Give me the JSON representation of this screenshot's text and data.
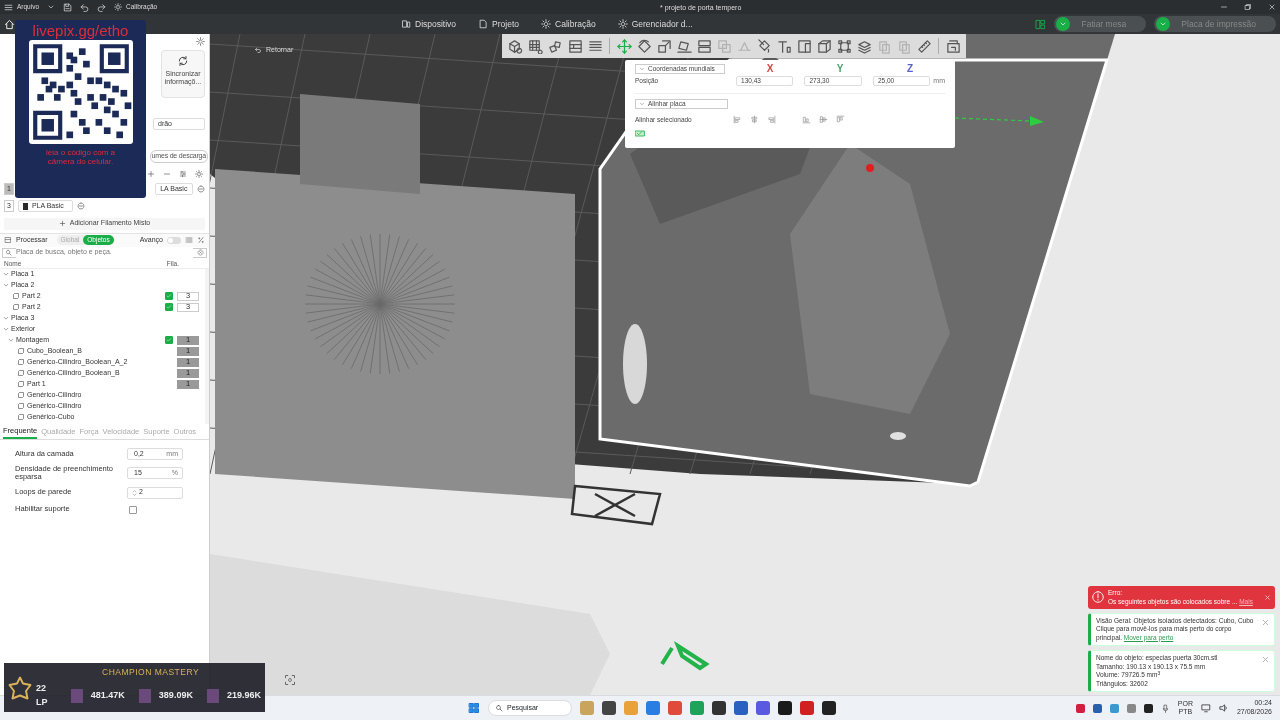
{
  "window": {
    "menu": "Arquivo",
    "quick_action": "Calibração",
    "title": "* projeto de porta tempero"
  },
  "tabs": [
    {
      "label": "Dispositivo",
      "selected": false
    },
    {
      "label": "Projeto",
      "selected": false
    },
    {
      "label": "Calibração",
      "selected": false
    },
    {
      "label": "Gerenciador d...",
      "selected": false
    }
  ],
  "actions": [
    {
      "label": "Fatiar mesa",
      "disabled": true
    },
    {
      "label": "Placa de impressão",
      "disabled": true
    }
  ],
  "left_panel": {
    "sync_button": "Sincronizar informaçõ...",
    "nozzle_field": "drão",
    "flush_button": "umes de descarga",
    "filaments": [
      {
        "number": "1",
        "name": "LA Basic"
      },
      {
        "number": "3",
        "name": "PLA Basic",
        "color": "#2a2a2a"
      }
    ],
    "add_mixed": "Adicionar Filamento Misto"
  },
  "process": {
    "title": "Processar",
    "scopes": [
      {
        "label": "Global",
        "selected": false
      },
      {
        "label": "Objetos",
        "selected": true
      }
    ],
    "advanced_label": "Avanço",
    "advanced_on": false,
    "search_placeholder": "Placa de busca, objeto e peça."
  },
  "tree": {
    "columns": [
      "Nome",
      "Fila."
    ],
    "items": [
      {
        "label": "Placa 1",
        "expanded": true
      },
      {
        "label": "Placa 2",
        "expanded": true,
        "children": [
          {
            "label": "Part 2",
            "checked": true,
            "filament": "3",
            "filament_disabled": false
          },
          {
            "label": "Part 2",
            "checked": true,
            "filament": "3",
            "filament_disabled": false
          }
        ]
      },
      {
        "label": "Placa 3",
        "expanded": true
      },
      {
        "label": "Exterior",
        "expanded": true,
        "children": [
          {
            "label": "Montagem",
            "expanded": true,
            "checked": true,
            "filament": "1",
            "filament_disabled": true,
            "children": [
              {
                "label": "Cubo_Boolean_B",
                "filament": "1",
                "filament_disabled": true
              },
              {
                "label": "Genérico-Cilindro_Boolean_A_2",
                "filament": "1",
                "filament_disabled": true
              },
              {
                "label": "Genérico-Cilindro_Boolean_B",
                "filament": "1",
                "filament_disabled": true
              },
              {
                "label": "Part 1",
                "filament": "1",
                "filament_disabled": true
              },
              {
                "label": "Genérico-Cilindro"
              },
              {
                "label": "Genérico-Cilindro"
              },
              {
                "label": "Genérico-Cubo"
              }
            ]
          }
        ]
      }
    ]
  },
  "settings_tabs": [
    {
      "label": "Frequente",
      "selected": true
    },
    {
      "label": "Qualidade",
      "selected": false
    },
    {
      "label": "Força",
      "selected": false
    },
    {
      "label": "Velocidade",
      "selected": false
    },
    {
      "label": "Suporte",
      "selected": false
    },
    {
      "label": "Outros",
      "selected": false
    }
  ],
  "settings": [
    {
      "kind": "number",
      "label": "Altura da camada",
      "value": "0,2",
      "unit": "mm"
    },
    {
      "kind": "number",
      "label": "Densidade de preenchimento esparsa",
      "value": "15",
      "unit": "%"
    },
    {
      "kind": "spin",
      "label": "Loops de parede",
      "value": "2"
    },
    {
      "kind": "checkbox",
      "label": "Habilitar suporte",
      "checked": false
    }
  ],
  "viewport": {
    "back_button": "Retornar"
  },
  "toolbar": [
    {
      "kind": "tool",
      "disabled": false
    },
    {
      "kind": "tool",
      "disabled": false
    },
    {
      "kind": "tool",
      "disabled": false
    },
    {
      "kind": "tool",
      "disabled": false
    },
    {
      "kind": "tool",
      "disabled": false
    },
    {
      "kind": "separator"
    },
    {
      "kind": "tool",
      "disabled": false
    },
    {
      "kind": "tool",
      "disabled": false
    },
    {
      "kind": "tool",
      "disabled": false
    },
    {
      "kind": "tool",
      "disabled": false
    },
    {
      "kind": "tool",
      "disabled": false
    },
    {
      "kind": "tool",
      "disabled": true
    },
    {
      "kind": "tool",
      "disabled": true
    },
    {
      "kind": "tool",
      "disabled": false
    },
    {
      "kind": "tool",
      "disabled": false
    },
    {
      "kind": "tool",
      "disabled": false
    },
    {
      "kind": "tool",
      "disabled": false
    },
    {
      "kind": "tool",
      "disabled": false
    },
    {
      "kind": "tool",
      "disabled": false
    },
    {
      "kind": "tool",
      "disabled": true
    },
    {
      "kind": "tool",
      "disabled": true
    },
    {
      "kind": "tool",
      "disabled": false
    },
    {
      "kind": "separator"
    },
    {
      "kind": "tool",
      "disabled": false
    }
  ],
  "position_panel": {
    "coord_system": "Coordenadas mundiais",
    "position_label": "Posição",
    "unit": "mm",
    "axes": [
      {
        "label": "X",
        "value": "130,43",
        "color": "#d04848"
      },
      {
        "label": "Y",
        "value": "273,30",
        "color": "#4aa46a"
      },
      {
        "label": "Z",
        "value": "25,00",
        "color": "#5a62c8"
      }
    ],
    "align_dropdown": "Alinhar placa",
    "align_label": "Alinhar selecionado"
  },
  "notifications": [
    {
      "kind": "error",
      "title": "Erro:",
      "text": "Os seguintes objetos são colocados sobre ...",
      "link": "Mais"
    },
    {
      "kind": "info",
      "lines": [
        "Visão Geral: Objetos isolados detectados: Cubo, Cubo",
        "Clique para movê-los para mais perto do corpo principal."
      ],
      "link": "Mover para perto"
    },
    {
      "kind": "info",
      "lines": [
        "Nome do objeto: especias puerta 30cm.stl",
        "Tamanho: 190.13 x 190.13 x 75.5 mm",
        "Volume: 79726.5 mm$^{3}$",
        "Triângulos: 32602"
      ]
    }
  ],
  "overlays": {
    "qr": {
      "url": "livepix.gg/etho",
      "caption": "leia o código com a câmera do celular."
    },
    "mastery": {
      "title": "CHAMPION MASTERY",
      "rank": "22 LP",
      "scores": [
        "481.47K",
        "389.09K",
        "219.96K"
      ]
    }
  },
  "taskbar": {
    "search_placeholder": "Pesquisar",
    "language": [
      "POR",
      "PTB"
    ],
    "time": "00:24",
    "date": "27/08/2026"
  }
}
